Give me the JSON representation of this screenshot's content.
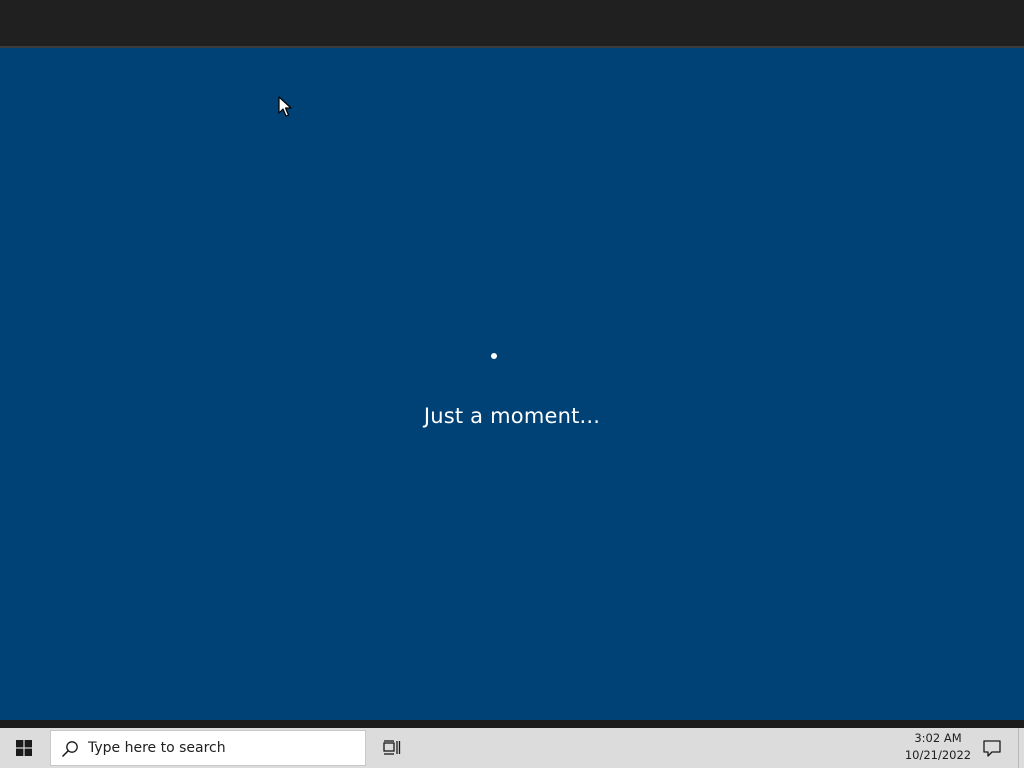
{
  "screen": {
    "background_color": "#004275",
    "titlebar_color": "#202020"
  },
  "oobe": {
    "message": "Just a moment...",
    "spinner_icon": "loading-spinner-icon"
  },
  "taskbar": {
    "background_color": "#dcdcdc",
    "start_icon": "windows-logo-icon",
    "search": {
      "placeholder": "Type here to search",
      "icon": "search-icon"
    },
    "task_view_icon": "task-view-icon",
    "clock": {
      "time": "3:02 AM",
      "date": "10/21/2022"
    },
    "notification_icon": "notification-icon"
  }
}
